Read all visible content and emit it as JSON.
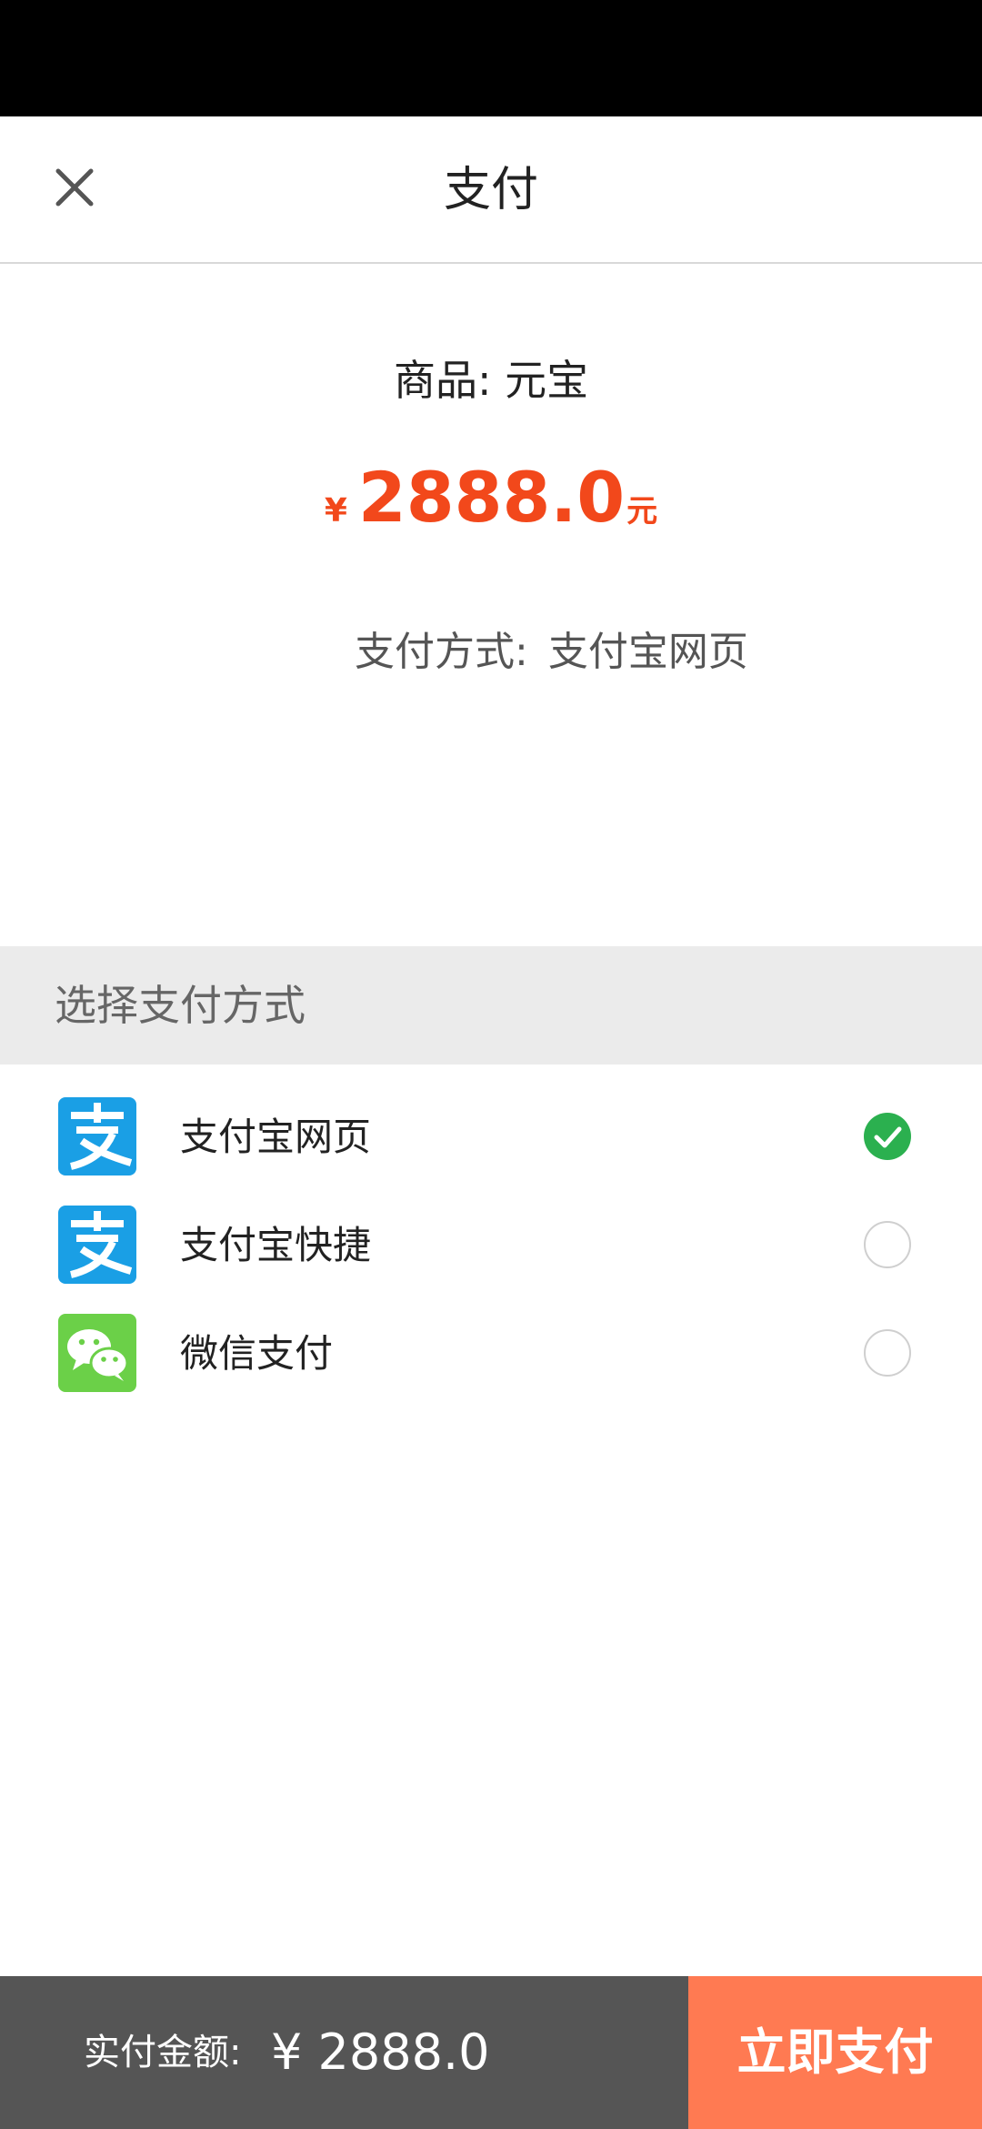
{
  "header": {
    "title": "支付",
    "close_icon": "close-icon"
  },
  "summary": {
    "product_label": "商品:",
    "product_name": "元宝",
    "currency_symbol": "¥",
    "amount": "2888.0",
    "unit": "元",
    "method_label": "支付方式:",
    "method_value": "支付宝网页",
    "accent_color": "#f2481b"
  },
  "section": {
    "title": "选择支付方式"
  },
  "payment_options": [
    {
      "label": "支付宝网页",
      "icon": "alipay-icon",
      "selected": true
    },
    {
      "label": "支付宝快捷",
      "icon": "alipay-icon",
      "selected": false
    },
    {
      "label": "微信支付",
      "icon": "wechat-pay-icon",
      "selected": false
    }
  ],
  "footer": {
    "total_label": "实付金额:",
    "total_amount": "¥ 2888.0",
    "pay_button_label": "立即支付",
    "pay_button_color": "#ff7a52"
  }
}
